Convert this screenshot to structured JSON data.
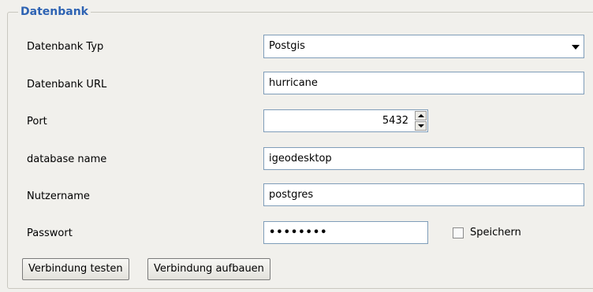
{
  "group": {
    "title": "Datenbank"
  },
  "fields": {
    "type_label": "Datenbank Typ",
    "type_value": "Postgis",
    "url_label": "Datenbank URL",
    "url_value": "hurricane",
    "port_label": "Port",
    "port_value": "5432",
    "dbname_label": "database name",
    "dbname_value": "igeodesktop",
    "user_label": "Nutzername",
    "user_value": "postgres",
    "password_label": "Passwort",
    "password_value": "••••••••",
    "save_label": "Speichern",
    "save_checked": false
  },
  "buttons": {
    "test": "Verbindung testen",
    "connect": "Verbindung aufbauen"
  },
  "icons": {
    "combo_arrow": "chevron-down-icon",
    "spin_up": "arrow-up-icon",
    "spin_down": "arrow-down-icon"
  }
}
